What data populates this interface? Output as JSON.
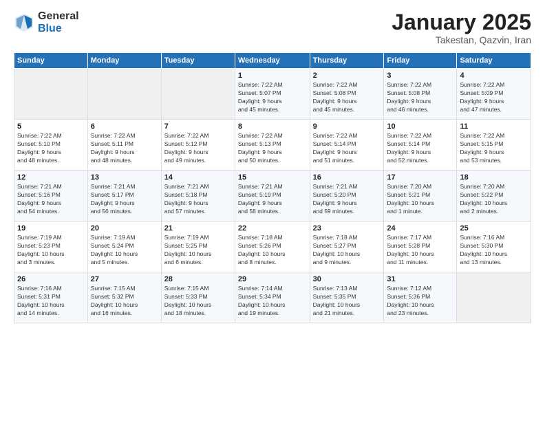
{
  "logo": {
    "general": "General",
    "blue": "Blue"
  },
  "header": {
    "month": "January 2025",
    "location": "Takestan, Qazvin, Iran"
  },
  "weekdays": [
    "Sunday",
    "Monday",
    "Tuesday",
    "Wednesday",
    "Thursday",
    "Friday",
    "Saturday"
  ],
  "weeks": [
    [
      {
        "day": "",
        "info": ""
      },
      {
        "day": "",
        "info": ""
      },
      {
        "day": "",
        "info": ""
      },
      {
        "day": "1",
        "info": "Sunrise: 7:22 AM\nSunset: 5:07 PM\nDaylight: 9 hours\nand 45 minutes."
      },
      {
        "day": "2",
        "info": "Sunrise: 7:22 AM\nSunset: 5:08 PM\nDaylight: 9 hours\nand 45 minutes."
      },
      {
        "day": "3",
        "info": "Sunrise: 7:22 AM\nSunset: 5:08 PM\nDaylight: 9 hours\nand 46 minutes."
      },
      {
        "day": "4",
        "info": "Sunrise: 7:22 AM\nSunset: 5:09 PM\nDaylight: 9 hours\nand 47 minutes."
      }
    ],
    [
      {
        "day": "5",
        "info": "Sunrise: 7:22 AM\nSunset: 5:10 PM\nDaylight: 9 hours\nand 48 minutes."
      },
      {
        "day": "6",
        "info": "Sunrise: 7:22 AM\nSunset: 5:11 PM\nDaylight: 9 hours\nand 48 minutes."
      },
      {
        "day": "7",
        "info": "Sunrise: 7:22 AM\nSunset: 5:12 PM\nDaylight: 9 hours\nand 49 minutes."
      },
      {
        "day": "8",
        "info": "Sunrise: 7:22 AM\nSunset: 5:13 PM\nDaylight: 9 hours\nand 50 minutes."
      },
      {
        "day": "9",
        "info": "Sunrise: 7:22 AM\nSunset: 5:14 PM\nDaylight: 9 hours\nand 51 minutes."
      },
      {
        "day": "10",
        "info": "Sunrise: 7:22 AM\nSunset: 5:14 PM\nDaylight: 9 hours\nand 52 minutes."
      },
      {
        "day": "11",
        "info": "Sunrise: 7:22 AM\nSunset: 5:15 PM\nDaylight: 9 hours\nand 53 minutes."
      }
    ],
    [
      {
        "day": "12",
        "info": "Sunrise: 7:21 AM\nSunset: 5:16 PM\nDaylight: 9 hours\nand 54 minutes."
      },
      {
        "day": "13",
        "info": "Sunrise: 7:21 AM\nSunset: 5:17 PM\nDaylight: 9 hours\nand 56 minutes."
      },
      {
        "day": "14",
        "info": "Sunrise: 7:21 AM\nSunset: 5:18 PM\nDaylight: 9 hours\nand 57 minutes."
      },
      {
        "day": "15",
        "info": "Sunrise: 7:21 AM\nSunset: 5:19 PM\nDaylight: 9 hours\nand 58 minutes."
      },
      {
        "day": "16",
        "info": "Sunrise: 7:21 AM\nSunset: 5:20 PM\nDaylight: 9 hours\nand 59 minutes."
      },
      {
        "day": "17",
        "info": "Sunrise: 7:20 AM\nSunset: 5:21 PM\nDaylight: 10 hours\nand 1 minute."
      },
      {
        "day": "18",
        "info": "Sunrise: 7:20 AM\nSunset: 5:22 PM\nDaylight: 10 hours\nand 2 minutes."
      }
    ],
    [
      {
        "day": "19",
        "info": "Sunrise: 7:19 AM\nSunset: 5:23 PM\nDaylight: 10 hours\nand 3 minutes."
      },
      {
        "day": "20",
        "info": "Sunrise: 7:19 AM\nSunset: 5:24 PM\nDaylight: 10 hours\nand 5 minutes."
      },
      {
        "day": "21",
        "info": "Sunrise: 7:19 AM\nSunset: 5:25 PM\nDaylight: 10 hours\nand 6 minutes."
      },
      {
        "day": "22",
        "info": "Sunrise: 7:18 AM\nSunset: 5:26 PM\nDaylight: 10 hours\nand 8 minutes."
      },
      {
        "day": "23",
        "info": "Sunrise: 7:18 AM\nSunset: 5:27 PM\nDaylight: 10 hours\nand 9 minutes."
      },
      {
        "day": "24",
        "info": "Sunrise: 7:17 AM\nSunset: 5:28 PM\nDaylight: 10 hours\nand 11 minutes."
      },
      {
        "day": "25",
        "info": "Sunrise: 7:16 AM\nSunset: 5:30 PM\nDaylight: 10 hours\nand 13 minutes."
      }
    ],
    [
      {
        "day": "26",
        "info": "Sunrise: 7:16 AM\nSunset: 5:31 PM\nDaylight: 10 hours\nand 14 minutes."
      },
      {
        "day": "27",
        "info": "Sunrise: 7:15 AM\nSunset: 5:32 PM\nDaylight: 10 hours\nand 16 minutes."
      },
      {
        "day": "28",
        "info": "Sunrise: 7:15 AM\nSunset: 5:33 PM\nDaylight: 10 hours\nand 18 minutes."
      },
      {
        "day": "29",
        "info": "Sunrise: 7:14 AM\nSunset: 5:34 PM\nDaylight: 10 hours\nand 19 minutes."
      },
      {
        "day": "30",
        "info": "Sunrise: 7:13 AM\nSunset: 5:35 PM\nDaylight: 10 hours\nand 21 minutes."
      },
      {
        "day": "31",
        "info": "Sunrise: 7:12 AM\nSunset: 5:36 PM\nDaylight: 10 hours\nand 23 minutes."
      },
      {
        "day": "",
        "info": ""
      }
    ]
  ]
}
